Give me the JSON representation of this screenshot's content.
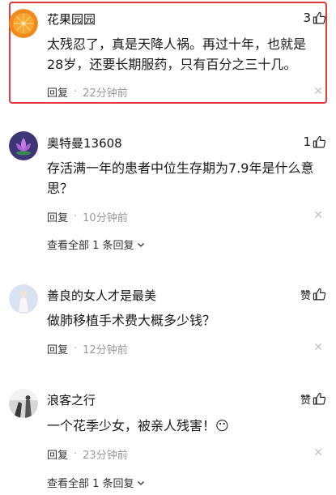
{
  "comments": [
    {
      "username": "花果园园",
      "likes": "3",
      "content": "太残忍了，真是天降人祸。再过十年，也就是28岁，还要长期服药，只有百分之三十几。",
      "reply_label": "回复",
      "time": "22分钟前",
      "highlighted": true
    },
    {
      "username": "奥特曼13608",
      "likes": "1",
      "content": "存活满一年的患者中位生存期为7.9年是什么意思？",
      "reply_label": "回复",
      "time": "10分钟前",
      "replies_label": "查看全部 1 条回复"
    },
    {
      "username": "善良的女人才是最美",
      "likes": "赞",
      "content": "做肺移植手术费大概多少钱？",
      "reply_label": "回复",
      "time": "12分钟前"
    },
    {
      "username": "浪客之行",
      "likes": "赞",
      "content": "一个花季少女，被亲人残害！😶",
      "reply_label": "回复",
      "time": "23分钟前",
      "replies_label": "查看全部 1 条回复"
    }
  ],
  "colors": {
    "highlight_border": "#e23a3a",
    "meta_time": "#999999"
  },
  "icons": {
    "like": "thumbs-up-icon",
    "close": "close-icon",
    "expand": "chevron-down-icon"
  }
}
